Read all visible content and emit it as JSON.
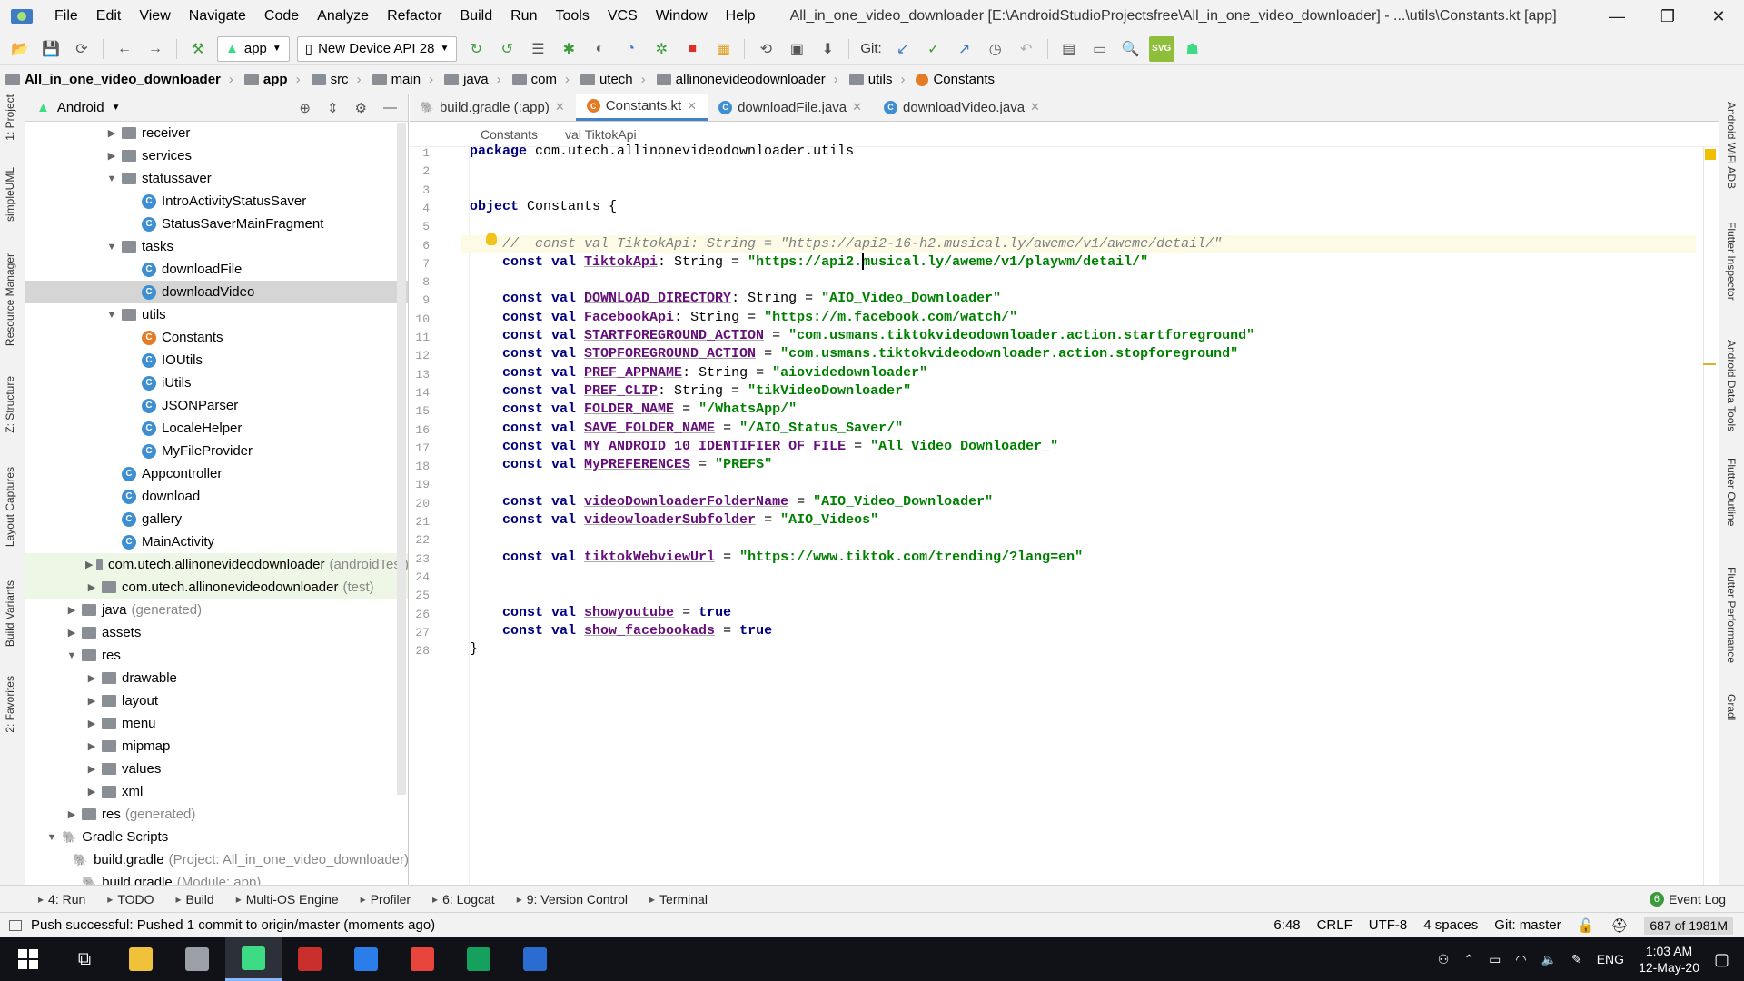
{
  "window": {
    "title": "All_in_one_video_downloader [E:\\AndroidStudioProjectsfree\\All_in_one_video_downloader] - ...\\utils\\Constants.kt [app]"
  },
  "menu": [
    "File",
    "Edit",
    "View",
    "Navigate",
    "Code",
    "Analyze",
    "Refactor",
    "Build",
    "Run",
    "Tools",
    "VCS",
    "Window",
    "Help"
  ],
  "toolbar": {
    "config": "app",
    "device": "New Device API 28",
    "git_label": "Git:"
  },
  "breadcrumb": [
    "All_in_one_video_downloader",
    "app",
    "src",
    "main",
    "java",
    "com",
    "utech",
    "allinonevideodownloader",
    "utils",
    "Constants"
  ],
  "left_strip": [
    "1: Project",
    "simpleUML",
    "Resource Manager",
    "Z: Structure",
    "Layout Captures",
    "Build Variants",
    "2: Favorites"
  ],
  "right_strip": [
    "Android WiFi ADB",
    "Flutter Inspector",
    "Android Data Tools",
    "Flutter Outline",
    "Flutter Performance",
    "Gradl"
  ],
  "project_panel": {
    "view": "Android",
    "nodes": [
      {
        "indent": 3,
        "arrow": "▶",
        "kind": "folder",
        "label": "receiver",
        "extra": ""
      },
      {
        "indent": 3,
        "arrow": "▶",
        "kind": "folder",
        "label": "services",
        "extra": ""
      },
      {
        "indent": 3,
        "arrow": "▼",
        "kind": "folder",
        "label": "statussaver",
        "extra": ""
      },
      {
        "indent": 4,
        "arrow": "",
        "kind": "class",
        "label": "IntroActivityStatusSaver",
        "extra": ""
      },
      {
        "indent": 4,
        "arrow": "",
        "kind": "class",
        "label": "StatusSaverMainFragment",
        "extra": ""
      },
      {
        "indent": 3,
        "arrow": "▼",
        "kind": "folder",
        "label": "tasks",
        "extra": ""
      },
      {
        "indent": 4,
        "arrow": "",
        "kind": "class",
        "label": "downloadFile",
        "extra": ""
      },
      {
        "indent": 4,
        "arrow": "",
        "kind": "class",
        "label": "downloadVideo",
        "extra": "",
        "selected": true
      },
      {
        "indent": 3,
        "arrow": "▼",
        "kind": "folder",
        "label": "utils",
        "extra": ""
      },
      {
        "indent": 4,
        "arrow": "",
        "kind": "kotlin",
        "label": "Constants",
        "extra": ""
      },
      {
        "indent": 4,
        "arrow": "",
        "kind": "class",
        "label": "IOUtils",
        "extra": ""
      },
      {
        "indent": 4,
        "arrow": "",
        "kind": "class",
        "label": "iUtils",
        "extra": ""
      },
      {
        "indent": 4,
        "arrow": "",
        "kind": "class",
        "label": "JSONParser",
        "extra": ""
      },
      {
        "indent": 4,
        "arrow": "",
        "kind": "class",
        "label": "LocaleHelper",
        "extra": ""
      },
      {
        "indent": 4,
        "arrow": "",
        "kind": "class",
        "label": "MyFileProvider",
        "extra": ""
      },
      {
        "indent": 3,
        "arrow": "",
        "kind": "class",
        "label": "Appcontroller",
        "extra": ""
      },
      {
        "indent": 3,
        "arrow": "",
        "kind": "class",
        "label": "download",
        "extra": ""
      },
      {
        "indent": 3,
        "arrow": "",
        "kind": "class",
        "label": "gallery",
        "extra": ""
      },
      {
        "indent": 3,
        "arrow": "",
        "kind": "class",
        "label": "MainActivity",
        "extra": ""
      },
      {
        "indent": 2,
        "arrow": "▶",
        "kind": "folder",
        "label": "com.utech.allinonevideodownloader",
        "extra": "(androidTest)",
        "test": true
      },
      {
        "indent": 2,
        "arrow": "▶",
        "kind": "folder",
        "label": "com.utech.allinonevideodownloader",
        "extra": "(test)",
        "test": true
      },
      {
        "indent": 1,
        "arrow": "▶",
        "kind": "folder",
        "label": "java",
        "extra": "(generated)"
      },
      {
        "indent": 1,
        "arrow": "▶",
        "kind": "folder",
        "label": "assets",
        "extra": ""
      },
      {
        "indent": 1,
        "arrow": "▼",
        "kind": "folder",
        "label": "res",
        "extra": ""
      },
      {
        "indent": 2,
        "arrow": "▶",
        "kind": "folder",
        "label": "drawable",
        "extra": ""
      },
      {
        "indent": 2,
        "arrow": "▶",
        "kind": "folder",
        "label": "layout",
        "extra": ""
      },
      {
        "indent": 2,
        "arrow": "▶",
        "kind": "folder",
        "label": "menu",
        "extra": ""
      },
      {
        "indent": 2,
        "arrow": "▶",
        "kind": "folder",
        "label": "mipmap",
        "extra": ""
      },
      {
        "indent": 2,
        "arrow": "▶",
        "kind": "folder",
        "label": "values",
        "extra": ""
      },
      {
        "indent": 2,
        "arrow": "▶",
        "kind": "folder",
        "label": "xml",
        "extra": ""
      },
      {
        "indent": 1,
        "arrow": "▶",
        "kind": "folder",
        "label": "res",
        "extra": "(generated)"
      },
      {
        "indent": 0,
        "arrow": "▼",
        "kind": "gradle",
        "label": "Gradle Scripts",
        "extra": ""
      },
      {
        "indent": 1,
        "arrow": "",
        "kind": "gradle",
        "label": "build.gradle",
        "extra": "(Project: All_in_one_video_downloader)"
      },
      {
        "indent": 1,
        "arrow": "",
        "kind": "gradle",
        "label": "build.gradle",
        "extra": "(Module: app)"
      }
    ]
  },
  "editor": {
    "tabs": [
      {
        "label": "build.gradle (:app)",
        "kind": "gradle",
        "active": false
      },
      {
        "label": "Constants.kt",
        "kind": "kotlin",
        "active": true
      },
      {
        "label": "downloadFile.java",
        "kind": "class",
        "active": false
      },
      {
        "label": "downloadVideo.java",
        "kind": "class",
        "active": false
      }
    ],
    "crumbs": [
      "Constants",
      "val TiktokApi"
    ],
    "lines": [
      {
        "n": "1",
        "tokens": [
          [
            "kw",
            "package "
          ],
          [
            "plain",
            "com.utech.allinonevideodownloader.utils"
          ]
        ]
      },
      {
        "n": "2",
        "tokens": []
      },
      {
        "n": "3",
        "tokens": []
      },
      {
        "n": "4",
        "tokens": [
          [
            "kw",
            "object "
          ],
          [
            "plain",
            "Constants {"
          ]
        ]
      },
      {
        "n": "5",
        "tokens": []
      },
      {
        "n": "6",
        "hl": true,
        "tokens": [
          [
            "cm",
            "    //  const val TiktokApi: String = \"https://api2-16-h2.musical.ly/aweme/v1/aweme/detail/\""
          ]
        ]
      },
      {
        "n": "7",
        "tokens": [
          [
            "kw",
            "    const val "
          ],
          [
            "prop",
            "TiktokApi"
          ],
          [
            "plain",
            ": String = "
          ],
          [
            "str",
            "\"https://api2.musical.ly/aweme/v1/playwm/detail/\""
          ]
        ]
      },
      {
        "n": "8",
        "tokens": []
      },
      {
        "n": "9",
        "tokens": [
          [
            "kw",
            "    const val "
          ],
          [
            "prop",
            "DOWNLOAD_DIRECTORY"
          ],
          [
            "plain",
            ": String = "
          ],
          [
            "str",
            "\"AIO_Video_Downloader\""
          ]
        ]
      },
      {
        "n": "10",
        "tokens": [
          [
            "kw",
            "    const val "
          ],
          [
            "prop",
            "FacebookApi"
          ],
          [
            "plain",
            ": String = "
          ],
          [
            "str",
            "\"https://m.facebook.com/watch/\""
          ]
        ]
      },
      {
        "n": "11",
        "tokens": [
          [
            "kw",
            "    const val "
          ],
          [
            "prop",
            "STARTFOREGROUND_ACTION"
          ],
          [
            "plain",
            " = "
          ],
          [
            "str",
            "\"com.usmans.tiktokvideodownloader.action.startforeground\""
          ]
        ]
      },
      {
        "n": "12",
        "tokens": [
          [
            "kw",
            "    const val "
          ],
          [
            "prop",
            "STOPFOREGROUND_ACTION"
          ],
          [
            "plain",
            " = "
          ],
          [
            "str",
            "\"com.usmans.tiktokvideodownloader.action.stopforeground\""
          ]
        ]
      },
      {
        "n": "13",
        "tokens": [
          [
            "kw",
            "    const val "
          ],
          [
            "prop",
            "PREF_APPNAME"
          ],
          [
            "plain",
            ": String = "
          ],
          [
            "str",
            "\"aiovidedownloader\""
          ]
        ]
      },
      {
        "n": "14",
        "tokens": [
          [
            "kw",
            "    const val "
          ],
          [
            "prop",
            "PREF_CLIP"
          ],
          [
            "plain",
            ": String = "
          ],
          [
            "str",
            "\"tikVideoDownloader\""
          ]
        ]
      },
      {
        "n": "15",
        "tokens": [
          [
            "kw",
            "    const val "
          ],
          [
            "prop",
            "FOLDER_NAME"
          ],
          [
            "plain",
            " = "
          ],
          [
            "str",
            "\"/WhatsApp/\""
          ]
        ]
      },
      {
        "n": "16",
        "tokens": [
          [
            "kw",
            "    const val "
          ],
          [
            "prop",
            "SAVE_FOLDER_NAME"
          ],
          [
            "plain",
            " = "
          ],
          [
            "str",
            "\"/AIO_Status_Saver/\""
          ]
        ]
      },
      {
        "n": "17",
        "tokens": [
          [
            "kw",
            "    const val "
          ],
          [
            "prop",
            "MY_ANDROID_10_IDENTIFIER_OF_FILE"
          ],
          [
            "plain",
            " = "
          ],
          [
            "str",
            "\"All_Video_Downloader_\""
          ]
        ]
      },
      {
        "n": "18",
        "tokens": [
          [
            "kw",
            "    const val "
          ],
          [
            "prop",
            "MyPREFERENCES"
          ],
          [
            "plain",
            " = "
          ],
          [
            "str",
            "\"PREFS\""
          ]
        ]
      },
      {
        "n": "19",
        "tokens": []
      },
      {
        "n": "20",
        "tokens": [
          [
            "kw",
            "    const val "
          ],
          [
            "prop",
            "videoDownloaderFolderName"
          ],
          [
            "plain",
            " = "
          ],
          [
            "str",
            "\"AIO_Video_Downloader\""
          ]
        ]
      },
      {
        "n": "21",
        "tokens": [
          [
            "kw",
            "    const val "
          ],
          [
            "prop",
            "videowloaderSubfolder"
          ],
          [
            "plain",
            " = "
          ],
          [
            "str",
            "\"AIO_Videos\""
          ]
        ]
      },
      {
        "n": "22",
        "tokens": []
      },
      {
        "n": "23",
        "tokens": [
          [
            "kw",
            "    const val "
          ],
          [
            "prop",
            "tiktokWebviewUrl"
          ],
          [
            "plain",
            " = "
          ],
          [
            "str",
            "\"https://www.tiktok.com/trending/?lang=en\""
          ]
        ]
      },
      {
        "n": "24",
        "tokens": []
      },
      {
        "n": "25",
        "tokens": []
      },
      {
        "n": "26",
        "tokens": [
          [
            "kw",
            "    const val "
          ],
          [
            "prop",
            "showyoutube"
          ],
          [
            "plain",
            " = "
          ],
          [
            "kw",
            "true"
          ]
        ]
      },
      {
        "n": "27",
        "tokens": [
          [
            "kw",
            "    const val "
          ],
          [
            "prop",
            "show_facebookads"
          ],
          [
            "plain",
            " = "
          ],
          [
            "kw",
            "true"
          ]
        ]
      },
      {
        "n": "28",
        "tokens": [
          [
            "plain",
            "}"
          ]
        ]
      }
    ]
  },
  "bottom_tools": [
    "4: Run",
    "TODO",
    "Build",
    "Multi-OS Engine",
    "Profiler",
    "6: Logcat",
    "9: Version Control",
    "Terminal"
  ],
  "event_log": {
    "count": "6",
    "label": "Event Log"
  },
  "status": {
    "message": "Push successful: Pushed 1 commit to origin/master (moments ago)",
    "position": "6:48",
    "line_sep": "CRLF",
    "encoding": "UTF-8",
    "indent": "4 spaces",
    "branch": "Git: master",
    "memory": "687 of 1981M"
  },
  "taskbar": {
    "apps": [
      {
        "name": "file-explorer",
        "color": "#f0c23a"
      },
      {
        "name": "printer-app",
        "color": "#9aa0a6"
      },
      {
        "name": "android-studio",
        "color": "#3ddc84",
        "active": true
      },
      {
        "name": "red-app",
        "color": "#c9302c"
      },
      {
        "name": "mail-app",
        "color": "#2b7de9"
      },
      {
        "name": "chrome",
        "color": "#e8453c"
      },
      {
        "name": "green-app",
        "color": "#16a05d"
      },
      {
        "name": "word-app",
        "color": "#2b6cd0"
      }
    ],
    "lang": "ENG",
    "time": "1:03 AM",
    "date": "12-May-20"
  }
}
